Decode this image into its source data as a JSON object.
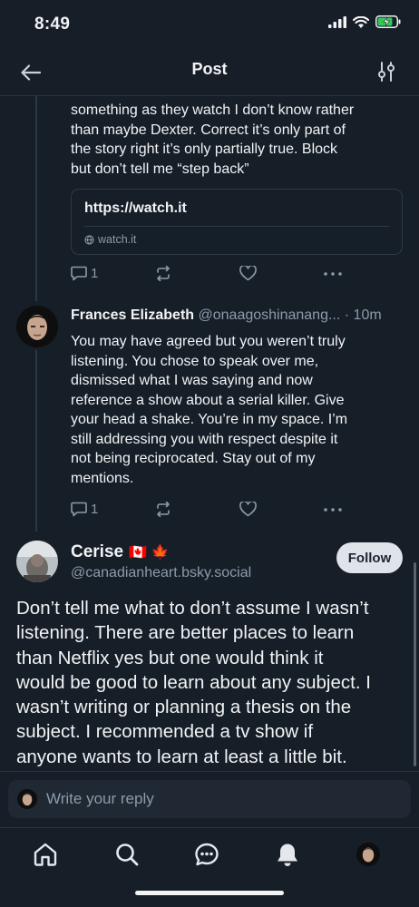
{
  "status_bar": {
    "time": "8:49"
  },
  "header": {
    "title": "Post"
  },
  "parent_post": {
    "lines": [
      "something as they watch I don’t know rather",
      "than maybe Dexter. Correct it’s only part of",
      "the story right it’s only partially true. Block",
      "but don’t tell me “step back”"
    ],
    "link": {
      "url": "https://watch.it",
      "domain": "watch.it"
    },
    "reply_count": "1"
  },
  "reply_post": {
    "author_name": "Frances Elizabeth",
    "author_handle": "@onaagoshinanang...",
    "time_ago": "· 10m",
    "lines": [
      "You may have agreed but you weren’t truly",
      "listening. You chose to  speak over me,",
      "dismissed what I was saying and now",
      "reference a show about a serial killer. Give",
      "your head a shake. You’re in my space. I’m",
      "still addressing you with respect despite it",
      "not being reciprocated. Stay out of my",
      "mentions."
    ],
    "reply_count": "1"
  },
  "focus_post": {
    "author_name": "Cerise",
    "flags": "🇨🇦 🍁",
    "author_handle": "@canadianheart.bsky.social",
    "follow_label": "Follow",
    "lines": [
      "Don’t tell me what to don’t assume I wasn’t",
      "listening. There are better places to learn",
      "than Netflix yes but one would think it",
      "would be good to learn about any subject. I",
      "wasn’t writing or planning a thesis on the",
      "subject. I recommended a tv show if",
      "anyone wants to learn at least a little bit."
    ]
  },
  "reply_bar": {
    "placeholder": "Write your reply"
  },
  "colors": {
    "background": "#161e27",
    "muted": "#8d9aab",
    "border": "#2b3642"
  }
}
